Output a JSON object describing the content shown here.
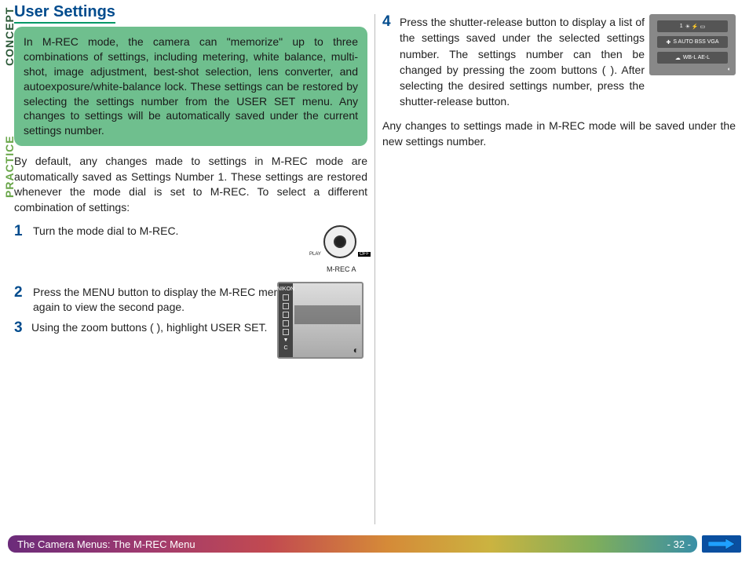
{
  "title": "User Settings",
  "sideLabels": {
    "concept": "CONCEPT",
    "practice": "PRACTICE"
  },
  "concept": "In M-REC mode, the camera can \"memorize\" up to three combinations of settings, including metering, white balance, multi-shot, image adjustment, best-shot selection, lens converter, and autoexposure/white-balance lock.  These settings can be restored by selecting the settings number from the USER SET menu.  Any changes to settings will be automatically saved under the current settings number.",
  "practice": "By default, any changes made to settings in M-REC mode are automatically saved as Settings Number 1.  These settings are restored whenever the mode dial is set to M-REC.  To select a different combination of settings:",
  "steps": [
    {
      "num": "1",
      "body": "Turn the mode dial to M-REC."
    },
    {
      "num": "2",
      "body": "Press the MENU button to display the M-REC menu, then press it again to view the second page."
    },
    {
      "num": "3",
      "body": "Using the zoom buttons (        ), highlight USER SET."
    }
  ],
  "step4": {
    "num": "4",
    "body": "Press the shutter-release button to display a list of the settings saved under the selected settings number.  The settings number can then be changed by pressing the zoom buttons (        ).  After selecting the desired settings number, press the shutter-release button."
  },
  "afterStep4": "Any changes to settings made in M-REC mode will be saved under the new settings number.",
  "dial": {
    "left": "PLAY",
    "right": "OFF",
    "bottom": "M-REC A"
  },
  "lcd": {
    "brand": "NIKON",
    "c": "C"
  },
  "miniLcd": {
    "row1": "1",
    "row2": "S  AUTO BSS VGA",
    "row3": "WB-L  AE-L"
  },
  "footer": {
    "text": "The Camera Menus: The M-REC Menu",
    "page": "- 32 -"
  }
}
